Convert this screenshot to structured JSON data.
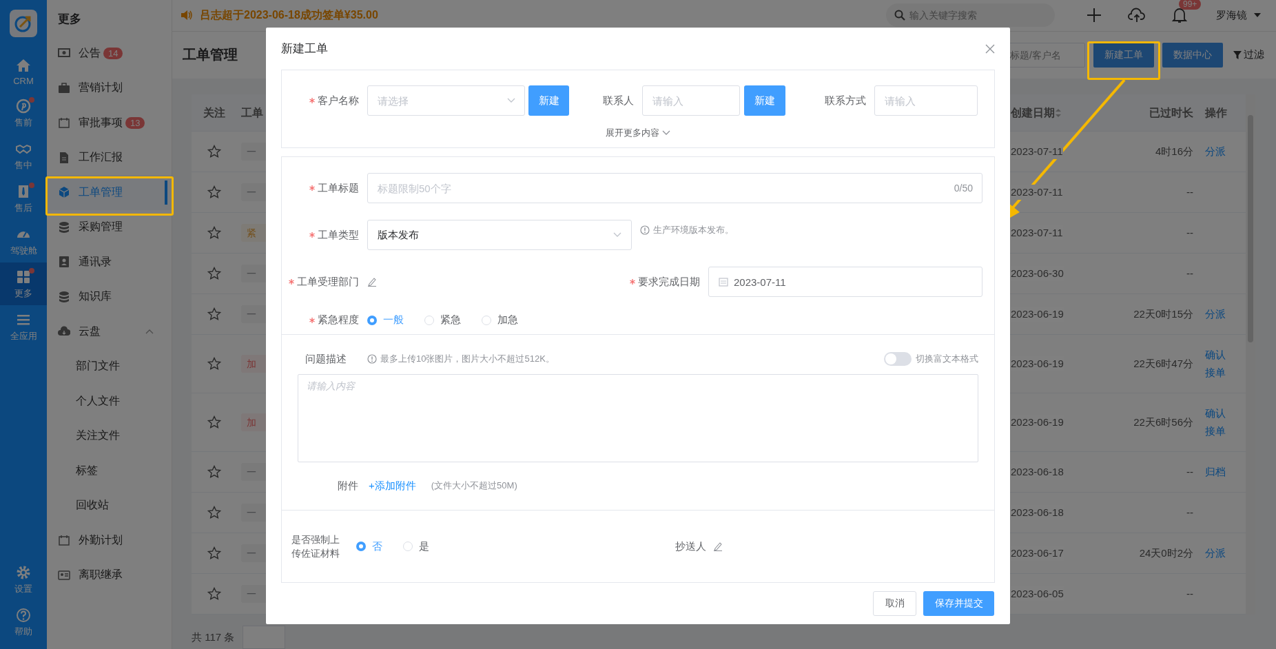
{
  "rail": {
    "items": [
      {
        "label": "CRM",
        "selected": false,
        "dot": false
      },
      {
        "label": "售前",
        "selected": false,
        "dot": true
      },
      {
        "label": "售中",
        "selected": false,
        "dot": false
      },
      {
        "label": "售后",
        "selected": false,
        "dot": true
      },
      {
        "label": "驾驶舱",
        "selected": false,
        "dot": false
      },
      {
        "label": "更多",
        "selected": true,
        "dot": true
      },
      {
        "label": "全应用",
        "selected": false,
        "dot": false
      }
    ],
    "bottom": [
      {
        "label": "设置"
      },
      {
        "label": "帮助"
      }
    ]
  },
  "sidebar": {
    "title": "更多",
    "items": [
      {
        "label": "公告",
        "badge": "14",
        "selected": false
      },
      {
        "label": "营销计划",
        "selected": false
      },
      {
        "label": "审批事项",
        "badge": "13",
        "selected": false
      },
      {
        "label": "工作汇报",
        "selected": false
      },
      {
        "label": "工单管理",
        "selected": true
      },
      {
        "label": "采购管理",
        "selected": false
      },
      {
        "label": "通讯录",
        "selected": false
      },
      {
        "label": "知识库",
        "selected": false
      },
      {
        "label": "云盘",
        "selected": false,
        "expanded": true,
        "children": [
          {
            "label": "部门文件",
            "selected": false
          },
          {
            "label": "个人文件",
            "selected": false
          },
          {
            "label": "关注文件",
            "selected": false
          },
          {
            "label": "标签",
            "selected": false
          },
          {
            "label": "回收站",
            "selected": false
          }
        ]
      },
      {
        "label": "外勤计划",
        "selected": false
      },
      {
        "label": "离职继承",
        "selected": false
      }
    ]
  },
  "top_bar": {
    "notice": "吕志超于2023-06-18成功签单¥35.00",
    "search": {
      "placeholder": "输入关键字搜索"
    },
    "notification_badge": "99+",
    "user": "罗海镜"
  },
  "page": {
    "title": "工单管理",
    "search": {
      "placeholder": "标题/客户名"
    },
    "buttons": [
      "新建工单",
      "数据中心"
    ],
    "filter": "过滤"
  },
  "table": {
    "columns": [
      "关注",
      "工单",
      "创建日期",
      "已过时长",
      "操作"
    ],
    "rows": [
      {
        "starred": false,
        "tag": {
          "text": "一",
          "kind": "normal"
        },
        "created": "2023-07-11",
        "elapsed": "4时16分",
        "actions": [
          "分派"
        ]
      },
      {
        "starred": false,
        "tag": {
          "text": "一",
          "kind": "normal"
        },
        "created": "2023-07-11",
        "elapsed": "--",
        "actions": []
      },
      {
        "starred": false,
        "tag": {
          "text": "紧",
          "kind": "urgent"
        },
        "created": "2023-07-11",
        "elapsed": "--",
        "actions": []
      },
      {
        "starred": false,
        "tag": {
          "text": "一",
          "kind": "normal"
        },
        "created": "2023-06-30",
        "elapsed": "--",
        "actions": []
      },
      {
        "starred": false,
        "tag": {
          "text": "一",
          "kind": "normal"
        },
        "created": "2023-06-19",
        "elapsed": "22天0时15分",
        "actions": [
          "分派"
        ]
      },
      {
        "starred": false,
        "tag": {
          "text": "加",
          "kind": "critical"
        },
        "created": "2023-06-19",
        "elapsed": "22天6时47分",
        "actions": [
          "确认接单"
        ]
      },
      {
        "starred": false,
        "tag": {
          "text": "加",
          "kind": "critical"
        },
        "created": "2023-06-19",
        "elapsed": "22天6时56分",
        "actions": [
          "确认接单"
        ]
      },
      {
        "starred": false,
        "tag": {
          "text": "一",
          "kind": "normal"
        },
        "created": "2023-06-18",
        "elapsed": "--",
        "actions": [
          "归档"
        ]
      },
      {
        "starred": false,
        "tag": {
          "text": "一",
          "kind": "normal"
        },
        "created": "2023-06-18",
        "elapsed": "--",
        "actions": []
      },
      {
        "starred": false,
        "tag": {
          "text": "一",
          "kind": "normal"
        },
        "created": "2023-06-17",
        "elapsed": "24天0时2分",
        "actions": [
          "分派"
        ]
      },
      {
        "starred": false,
        "tag": {
          "text": "一",
          "kind": "normal"
        },
        "created": "2023-06-05",
        "elapsed": "--",
        "actions": []
      }
    ],
    "total": "共 117 条"
  },
  "modal": {
    "title": "新建工单",
    "customer": {
      "label": "客户名称",
      "required": true,
      "placeholder": "请选择",
      "new_button": "新建"
    },
    "contact": {
      "label": "联系人",
      "placeholder": "请输入",
      "new_button": "新建"
    },
    "contact_method": {
      "label": "联系方式",
      "placeholder": "请输入"
    },
    "expand_link": "展开更多内容",
    "ticket_title": {
      "label": "工单标题",
      "required": true,
      "placeholder": "标题限制50个字",
      "counter": "0/50"
    },
    "ticket_type": {
      "label": "工单类型",
      "required": true,
      "value": "版本发布",
      "hint": "生产环境版本发布。"
    },
    "department": {
      "label": "工单受理部门",
      "required": true
    },
    "due_date": {
      "label": "要求完成日期",
      "required": true,
      "value": "2023-07-11"
    },
    "urgency": {
      "label": "紧急程度",
      "required": true,
      "options": [
        {
          "label": "一般",
          "selected": true
        },
        {
          "label": "紧急",
          "selected": false
        },
        {
          "label": "加急",
          "selected": false
        }
      ]
    },
    "description": {
      "label": "问题描述",
      "hint": "最多上传10张图片，图片大小不超过512K。",
      "rich_text_toggle": {
        "label": "切换富文本格式",
        "on": false
      },
      "placeholder": "请输入内容"
    },
    "attachment": {
      "label": "附件",
      "link": "+添加附件",
      "note": "(文件大小不超过50M)"
    },
    "require_evidence": {
      "label": "是否强制上传佐证材料",
      "options": [
        {
          "label": "否",
          "selected": true
        },
        {
          "label": "是",
          "selected": false
        }
      ]
    },
    "cc": {
      "label": "抄送人"
    },
    "buttons": {
      "cancel": "取消",
      "submit": "保存并提交"
    }
  }
}
